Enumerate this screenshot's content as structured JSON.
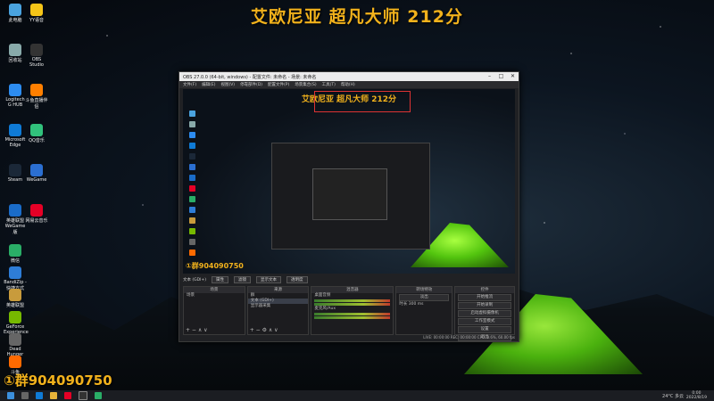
{
  "overlay": {
    "title": "艾欧尼亚  超凡大师 212分",
    "group": "①群904090750"
  },
  "desktop_icons": [
    {
      "label": "此电脑",
      "color": "#4aa3df"
    },
    {
      "label": "YY语音",
      "color": "#f5c518"
    },
    {
      "label": "回收站",
      "color": "#8aa"
    },
    {
      "label": "OBS Studio",
      "color": "#333"
    },
    {
      "label": "Logitech G HUB",
      "color": "#2d8cf0"
    },
    {
      "label": "斗鱼直播伴侣",
      "color": "#ff7f00"
    },
    {
      "label": "Microsoft Edge",
      "color": "#0f7bd6"
    },
    {
      "label": "QQ音乐",
      "color": "#31c27c"
    },
    {
      "label": "Steam",
      "color": "#1b2838"
    },
    {
      "label": "WeGame",
      "color": "#2b6fd1"
    },
    {
      "label": "英雄联盟WeGame版",
      "color": "#1a6cc9"
    },
    {
      "label": "网易云音乐",
      "color": "#e60026"
    },
    {
      "label": "微信",
      "color": "#2aae67"
    },
    {
      "label": "BandiZip - 快捷方式",
      "color": "#2e7dd7"
    },
    {
      "label": "英雄联盟",
      "color": "#c89b3c"
    },
    {
      "label": "GeForce Experience",
      "color": "#76b900"
    },
    {
      "label": "Dead Hunger",
      "color": "#666"
    },
    {
      "label": "斗鱼",
      "color": "#ff6a00"
    }
  ],
  "obs": {
    "title": "OBS 27.0.0 (64-bit, windows) - 配置文件: 未命名 - 场景: 未命名",
    "menu": [
      "文件(F)",
      "编辑(E)",
      "视图(V)",
      "停靠部件(D)",
      "配置文件(P)",
      "场景集合(S)",
      "工具(T)",
      "帮助(H)"
    ],
    "preview": {
      "title": "艾欧尼亚  超凡大师 212分",
      "group": "①群904090750"
    },
    "toolbar": {
      "source_label": "文本 (GDI+)",
      "properties": "属性",
      "filters": "滤镜",
      "edit_text": "显示文本",
      "text_settings": "透明度"
    },
    "docks": {
      "scenes": {
        "header": "场景",
        "items": [
          "场景"
        ]
      },
      "sources": {
        "header": "来源",
        "items": [
          "群",
          "文本 (GDI+)",
          "显示器采集"
        ]
      },
      "mixer": {
        "header": "混音器",
        "items": [
          "桌面音频",
          "麦克风/Aux"
        ]
      },
      "transitions": {
        "header": "转场特效",
        "type": "淡出",
        "duration_label": "时长",
        "duration": "300 ms"
      },
      "controls": {
        "header": "控件",
        "buttons": [
          "开始推流",
          "开始录制",
          "启动虚拟摄像机",
          "工作室模式",
          "设置",
          "退出"
        ]
      }
    },
    "status": "LIVE: 00:00:00   REC: 00:00:00   CPU: 0.6%, 60.00 fps"
  },
  "taskbar": {
    "weather": "24°C 多云",
    "time": "0:00",
    "date": "2022/8/19"
  }
}
